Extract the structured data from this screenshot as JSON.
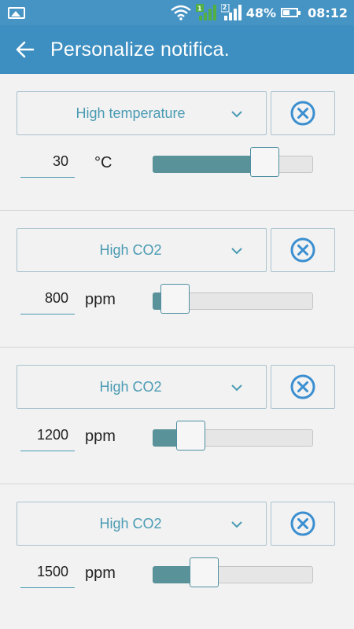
{
  "status_bar": {
    "battery_percent": "48%",
    "time": "08:12",
    "sim_badge": "2"
  },
  "header": {
    "title": "Personalize notifica."
  },
  "rules": [
    {
      "type": "High temperature",
      "value": "30",
      "unit": "°C",
      "slider_level": 0.7
    },
    {
      "type": "High CO2",
      "value": "800",
      "unit": "ppm",
      "slider_level": 0.14
    },
    {
      "type": "High CO2",
      "value": "1200",
      "unit": "ppm",
      "slider_level": 0.24
    },
    {
      "type": "High CO2",
      "value": "1500",
      "unit": "ppm",
      "slider_level": 0.32
    }
  ],
  "colors": {
    "app_bar": "#3e8fc1",
    "accent": "#4a9bb3",
    "slider_fill": "#5a9299",
    "remove_icon": "#3b8fd0"
  }
}
